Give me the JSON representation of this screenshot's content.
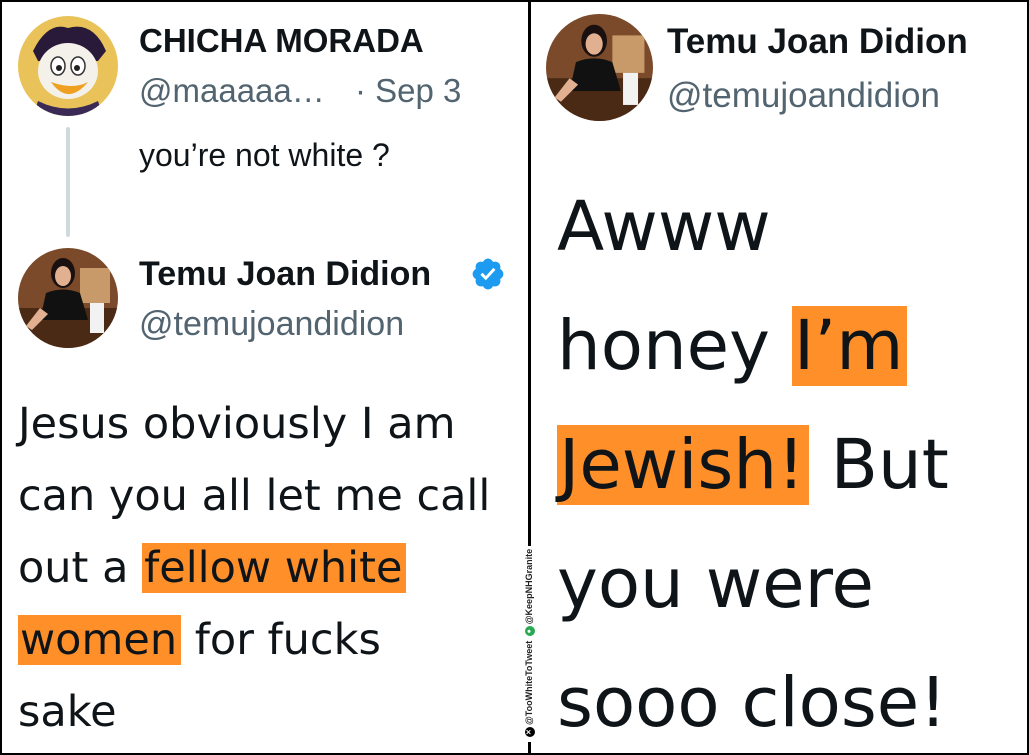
{
  "left_panel": {
    "reply": {
      "display_name": "CHICHA MORADA",
      "handle": "@maaaaa…",
      "date": "· Sep 3",
      "text": "you’re not white ?",
      "avatar_icon": "cartoon-duck-avatar"
    },
    "tweet": {
      "display_name": "Temu Joan Didion",
      "handle": "@temujoandidion",
      "verified": true,
      "avatar_icon": "woman-photo-avatar",
      "body_lines": [
        {
          "plain": "Jesus obviously I am"
        },
        {
          "plain": "can you all let me call"
        },
        {
          "plain_before": "out a ",
          "highlight": "fellow white"
        },
        {
          "highlight": "women",
          "plain_after": " for fucks"
        },
        {
          "plain": "sake"
        }
      ]
    }
  },
  "right_panel": {
    "tweet": {
      "display_name": "Temu Joan Didion",
      "handle": "@temujoandidion",
      "avatar_icon": "woman-photo-avatar",
      "body_lines": [
        {
          "plain": "Awww"
        },
        {
          "plain_before": "honey ",
          "highlight": "I’m"
        },
        {
          "highlight": "Jewish!",
          "plain_after": " But"
        },
        {
          "plain": "you were"
        },
        {
          "plain": "sooo close!"
        }
      ]
    }
  },
  "watermark": {
    "account_one": "@TooWhiteToTweet",
    "account_two": "@KeepNHGranite"
  },
  "colors": {
    "highlight": "#ff8f29",
    "handle_gray": "#536471",
    "verified_blue": "#1d9bf0",
    "thread_line": "#cfd9de"
  }
}
